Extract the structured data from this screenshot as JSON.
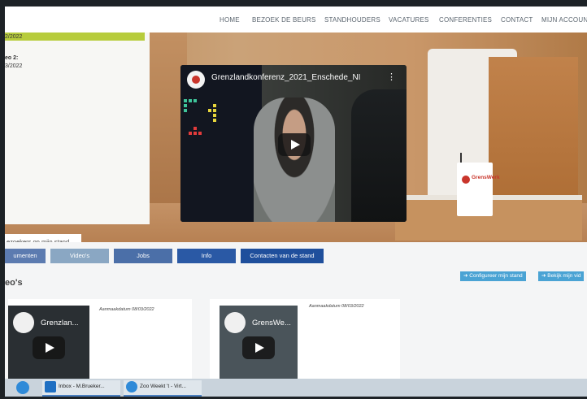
{
  "nav": {
    "items": [
      "HOME",
      "BEZOEK DE BEURS",
      "STANDHOUDERS",
      "VACATURES",
      "CONFERENTIES",
      "CONTACT",
      "MIJN ACCOUNT"
    ]
  },
  "sidepanel": {
    "date1": "2/2022",
    "label2": "eo 2:",
    "date2": "3/2022",
    "visitors": "ezoekers op mijn stand"
  },
  "video": {
    "title": "Grenzlandkonferenz_2021_Enschede_NI",
    "menu": "⋮"
  },
  "booth": {
    "logo_text": "GrensWerk"
  },
  "tabs": [
    {
      "label": "umenten",
      "color": "#5c7bb0"
    },
    {
      "label": "Video's",
      "color": "#8aa7c3"
    },
    {
      "label": "Jobs",
      "color": "#4b6fa8"
    },
    {
      "label": "Info",
      "color": "#2a59a5"
    },
    {
      "label": "Contacten van de stand",
      "color": "#1f4f9c"
    }
  ],
  "section": {
    "title": "eo's",
    "configure": "➜ Configureer mijn stand",
    "view": "➜ Bekijk mijn vid"
  },
  "cards": [
    {
      "thumb_title": "Grenzlan...",
      "date": "Aanmaakdatum 08/03/2022"
    },
    {
      "thumb_title": "GrensWe...",
      "date": "Aanmaakdatum 08/03/2022"
    }
  ],
  "taskbar": {
    "outlook": "Inbox - M.Brueker...",
    "edge": "Zoo Weekt 't - Virt..."
  }
}
